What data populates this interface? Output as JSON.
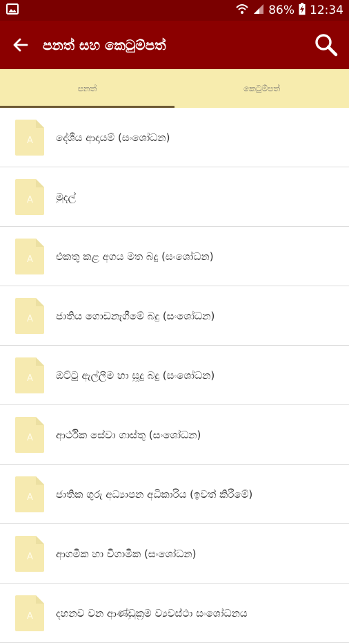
{
  "status_bar": {
    "battery": "86%",
    "time": "12:34"
  },
  "app_bar": {
    "title": "පනත් සහ කෙටුම්පත්"
  },
  "tabs": [
    {
      "label": "පනත්",
      "active": true
    },
    {
      "label": "කෙටුම්පත්",
      "active": false
    }
  ],
  "documents": [
    {
      "title": "දේශීය ආදායම් (සංශෝධන)"
    },
    {
      "title": "මුදල්"
    },
    {
      "title": "එකතු කළ අගය මත බදු (සංශෝධන)"
    },
    {
      "title": "ජාතිය ගොඩනැගීමේ බදු (සංශෝධන)"
    },
    {
      "title": "ඔට්ටු ඇල්ලීම හා සූදු බදු (සංශෝධන)"
    },
    {
      "title": "ආර්ථික සේවා ගාස්තු (සංශෝධන)"
    },
    {
      "title": "ජාතික ගුරු අධ්‍යාපන අධිකාරිය (ඉවත් කිරීමේ)"
    },
    {
      "title": "ආගමික හා විගාමික (සංශෝධන)"
    },
    {
      "title": "දහනව වන ආණ්ඩුක්‍රම ව්‍යවස්ථා සංශෝධනය"
    }
  ],
  "colors": {
    "status_bar": "#7a0000",
    "app_bar": "#8b0000",
    "tab_bg": "#f7ecae",
    "file_icon": "#f6eab0"
  },
  "icons": {
    "back": "arrow-left-icon",
    "search": "search-icon",
    "file": "document-file-icon"
  }
}
